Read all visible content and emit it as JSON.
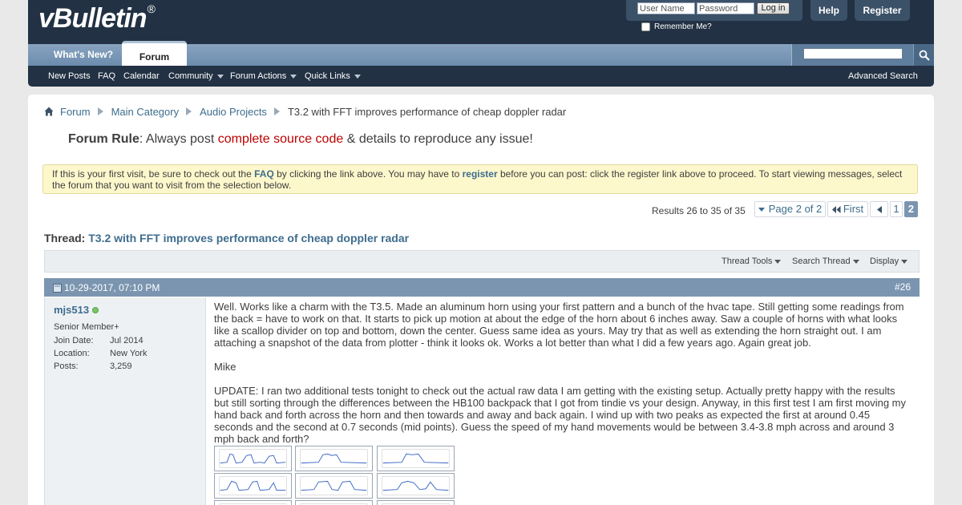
{
  "brand": {
    "logo_text": "vBulletin",
    "registered_mark": "®"
  },
  "login": {
    "user_placeholder": "User Name",
    "pass_placeholder": "Password",
    "button": "Log in",
    "remember": "Remember Me?"
  },
  "top_buttons": {
    "help": "Help",
    "register": "Register"
  },
  "tabs": {
    "whats_new": "What's New?",
    "forum": "Forum"
  },
  "subnav": {
    "new_posts": "New Posts",
    "faq": "FAQ",
    "calendar": "Calendar",
    "community": "Community",
    "forum_actions": "Forum Actions",
    "quick_links": "Quick Links",
    "advanced_search": "Advanced Search"
  },
  "breadcrumb": [
    "Forum",
    "Main Category",
    "Audio Projects",
    "T3.2 with FFT improves performance of cheap doppler radar"
  ],
  "forum_rule": {
    "label": "Forum Rule",
    "pre": ": Always post ",
    "highlight": "complete source code",
    "post": " & details to reproduce any issue!"
  },
  "notice": {
    "t1": "If this is your first visit, be sure to check out the ",
    "faq": "FAQ",
    "t2": " by clicking the link above. You may have to ",
    "register": "register",
    "t3": " before you can post: click the register link above to proceed. To start viewing messages, select the forum that you want to visit from the selection below."
  },
  "pagination": {
    "results": "Results 26 to 35 of 35",
    "page_label": "Page 2 of 2",
    "first": "First",
    "pages": [
      "1",
      "2"
    ]
  },
  "thread": {
    "label": "Thread:",
    "title": "T3.2 with FFT improves performance of cheap doppler radar"
  },
  "thread_tools": {
    "tools": "Thread Tools",
    "search": "Search Thread",
    "display": "Display"
  },
  "post": {
    "date": "10-29-2017,",
    "time": "07:10 PM",
    "number": "#26",
    "username": "mjs513",
    "user_title": "Senior Member+",
    "join_label": "Join Date:",
    "join_value": "Jul 2014",
    "location_label": "Location:",
    "location_value": "New York",
    "posts_label": "Posts:",
    "posts_value": "3,259",
    "para1": "Well. Works like a charm with the T3.5. Made an aluminum horn using your first pattern and a bunch of the hvac tape. Still getting some readings from the back = have to work on that. It starts to pick up motion at about the edge of the horn about 6 inches away. Saw a couple of horns with what looks like a scallop divider on top and bottom, down the center. Guess same idea as yours. May try that as well as extending the horn straight out. I am attaching a snapshot of the data from plotter - think it looks ok. Works a lot better than what I did a few years ago. Again great job.",
    "para2": "Mike",
    "para3": "UPDATE: I ran two additional tests tonight to check out the actual raw data I am getting with the existing setup. Actually pretty happy with the results but still sorting through the differences between the HB100 backpack that I got from tindie vs your design. Anyway, in this first test I am first moving my hand back and forth across the horn and then towards and away and back again. I wind up with two peaks as expected the first at around 0.45 seconds and the second at 0.7 seconds (mid points). Guess the speed of my hand movements would be between 3.4-3.8 mph across and around 3 mph back and forth?"
  },
  "colors": {
    "header_bg": "#223143",
    "nav_bg": "#7b95b0",
    "link": "#3e6d8e",
    "rule_red": "#bb0000",
    "notice_bg": "#fdf7cc"
  }
}
